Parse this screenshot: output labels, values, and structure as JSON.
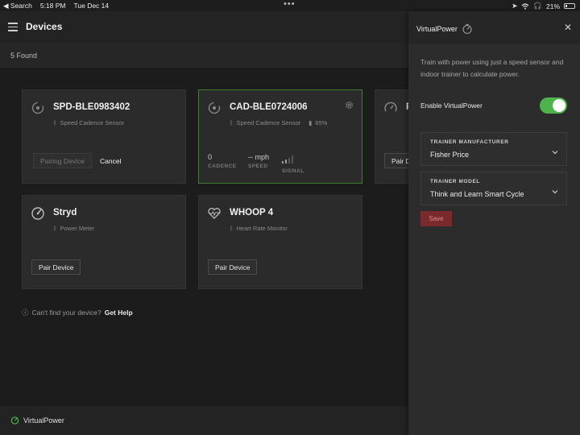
{
  "status_bar": {
    "back_label": "◀ Search",
    "time": "5:18 PM",
    "date": "Tue Dec 14",
    "battery_percent": "21%",
    "battery_level": 0.21
  },
  "header": {
    "title": "Devices"
  },
  "found_count": "5 Found",
  "devices": [
    {
      "name": "SPD-BLE0983402",
      "type": "Speed Cadence Sensor",
      "primary_button": "Pairing Device",
      "secondary_button": "Cancel"
    },
    {
      "name": "CAD-BLE0724006",
      "type": "Speed Cadence Sensor",
      "battery": "85%",
      "metrics": [
        {
          "value": "0",
          "label": "CADENCE"
        },
        {
          "value": "-- mph",
          "label": "SPEED"
        },
        {
          "value": "",
          "label": "SIGNAL"
        }
      ]
    },
    {
      "name": "F",
      "primary_button": "Pair D"
    },
    {
      "name": "Stryd",
      "type": "Power Meter",
      "primary_button": "Pair Device"
    },
    {
      "name": "WHOOP 4",
      "type": "Heart Rate Monitor",
      "primary_button": "Pair Device"
    }
  ],
  "help": {
    "text": "Can't find your device?",
    "link": "Get Help"
  },
  "footer": {
    "label": "VirtualPower"
  },
  "panel": {
    "title": "VirtualPower",
    "description": "Train with power using just a speed sensor and indoor trainer to calculate power.",
    "toggle_label": "Enable VirtualPower",
    "toggle_on": true,
    "manufacturer_label": "TRAINER MANUFACTURER",
    "manufacturer_value": "Fisher Price",
    "model_label": "TRAINER MODEL",
    "model_value": "Think and Learn Smart Cycle",
    "save_label": "Save"
  },
  "colors": {
    "accent_green": "#4db34a",
    "active_border": "#3e7b30",
    "save_red": "#7a2a2a"
  }
}
